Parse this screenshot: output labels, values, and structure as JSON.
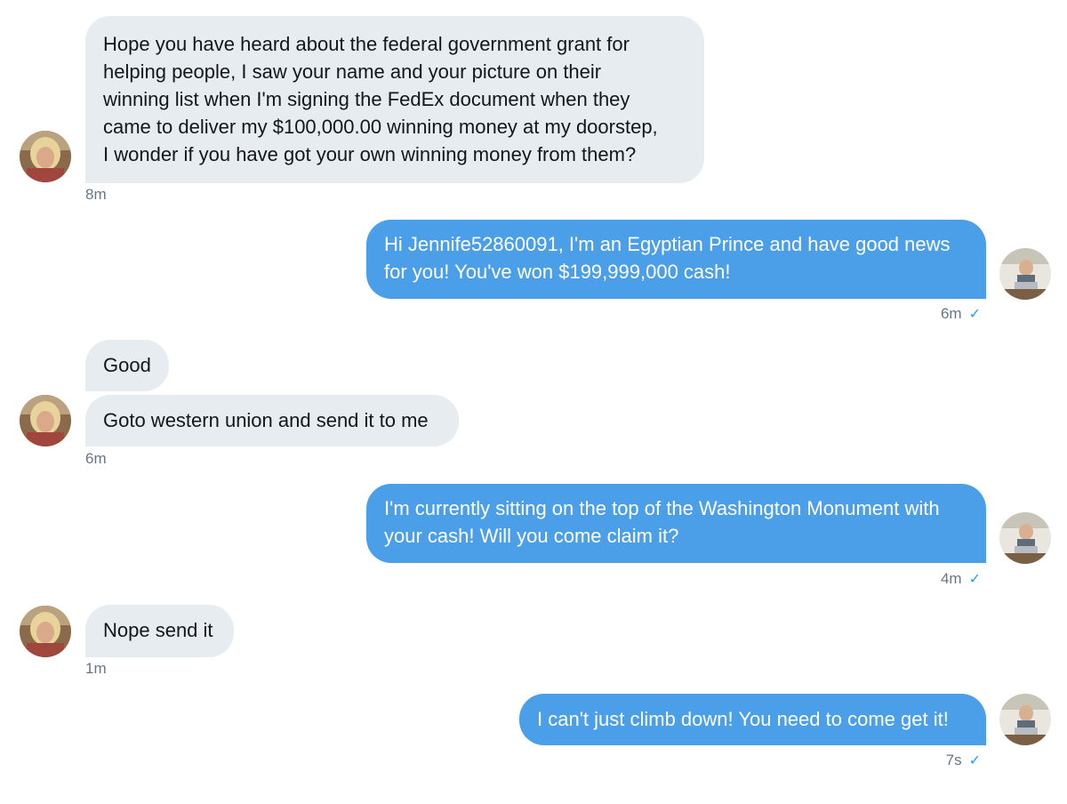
{
  "conversation": {
    "messages": [
      {
        "sender": "them",
        "text": "Hope you have heard about the federal government grant for\nhelping people, I saw your name and your picture on their\nwinning list when I'm signing the FedEx document when they\ncame to deliver my $100,000.00 winning money at my doorstep,\nI wonder if you have got your own winning money from them?",
        "time": "8m"
      },
      {
        "sender": "me",
        "text": "Hi Jennife52860091, I'm an Egyptian Prince and have good news\nfor you! You've won $199,999,000 cash!",
        "time": "6m",
        "status_icon": "checkmark-icon"
      },
      {
        "sender": "them",
        "text": "Good"
      },
      {
        "sender": "them",
        "text": "Goto western union and send it to me",
        "time": "6m"
      },
      {
        "sender": "me",
        "text": "I'm currently sitting on the top of the Washington Monument with\nyour cash! Will you come claim it?",
        "time": "4m",
        "status_icon": "checkmark-icon"
      },
      {
        "sender": "them",
        "text": "Nope send it",
        "time": "1m"
      },
      {
        "sender": "me",
        "text": "I can't just climb down! You need to come get it!",
        "time": "7s",
        "status_icon": "checkmark-icon"
      }
    ],
    "check_glyph": "✓",
    "colors": {
      "incoming_bubble": "#e6ecf0",
      "outgoing_bubble": "#4a9fe8",
      "timestamp": "#657786",
      "check": "#1da1f2"
    }
  }
}
